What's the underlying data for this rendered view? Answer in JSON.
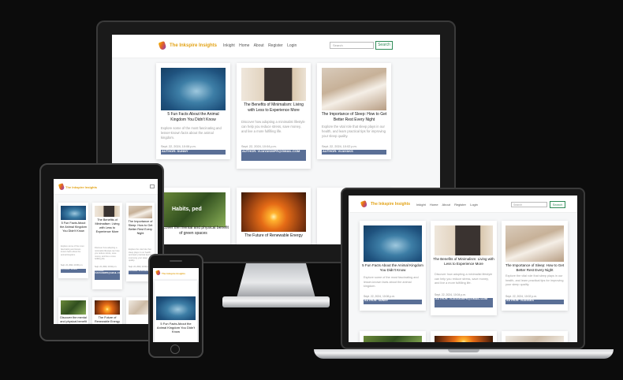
{
  "site": {
    "brand": "The Inkspire Insights",
    "nav": [
      "Inkight",
      "Home",
      "About",
      "Register",
      "Login"
    ],
    "search_placeholder": "Search",
    "search_button": "Search"
  },
  "posts": [
    {
      "title": "5 Fun Facts About the Animal Kingdom You Didn't Know",
      "excerpt": "Explore some of the most fascinating and lesser-known facts about the animal kingdom.",
      "date": "Sept. 22, 2024, 10:06 p.m.",
      "author": "AUTHOR: SUNNY"
    },
    {
      "title": "The Benefits of Minimalism: Living with Less to Experience More",
      "excerpt": "Discover how adopting a minimalist lifestyle can help you reduce stress, save money, and live a more fulfilling life.",
      "date": "Sept. 22, 2024, 10:04 p.m.",
      "author": "AUTHOR: VIJAYAKIMPR@GMAIL.COM"
    },
    {
      "title": "The Importance of Sleep: How to Get Better Rest Every Night",
      "excerpt": "Explore the vital role that sleep plays in our health, and learn practical tips for improving your sleep quality.",
      "date": "Sept. 22, 2024, 10:02 p.m.",
      "author": "AUTHOR: VIJAYAKS"
    },
    {
      "title": "Discover the mental and physical benefit of green spaces",
      "image_text": "Habits, ped"
    },
    {
      "title": "The Future of Renewable Energy"
    }
  ],
  "theme": {
    "brand_color": "#e2a215",
    "author_bar": "#5a6f96",
    "search_button": "#2e8b57"
  }
}
